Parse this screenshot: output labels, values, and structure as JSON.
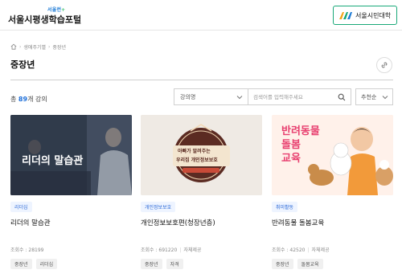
{
  "header": {
    "logo_small": "서울런",
    "logo_plus": "+",
    "logo_main": "서울시평생학습포털",
    "univ_button": "서울시민대학"
  },
  "breadcrumb": [
    "생애주기별",
    "중장년"
  ],
  "page": {
    "title": "중장년"
  },
  "filter": {
    "count_prefix": "총",
    "count": "89",
    "count_suffix": "개 강의",
    "select_value": "강의명",
    "search_placeholder": "검색어를 입력해주세요",
    "sort_value": "추천순"
  },
  "cards": [
    {
      "thumb_text": "리더의 말습관",
      "tag": "리더십",
      "title": "리더의 말습관",
      "views_label": "조회수 : 28199",
      "chips": [
        "중장년",
        "리더십"
      ]
    },
    {
      "thumb_text_1": "아빠가 알려주는",
      "thumb_text_2": "우리집 개인정보보호",
      "tag": "개인정보보호",
      "title": "개인정보보호편(청장년층)",
      "views_label": "조회수 : 691220",
      "source": "자체제공",
      "chips": [
        "중장년",
        "자격"
      ]
    },
    {
      "thumb_text_1": "반려동물",
      "thumb_text_2": "돌봄",
      "thumb_text_3": "교육",
      "tag": "취미활동",
      "title": "반려동물 돌봄교육",
      "views_label": "조회수 : 42520",
      "source": "자체제공",
      "chips": [
        "중장년",
        "돌봄교육"
      ]
    }
  ],
  "colors": {
    "accent_blue": "#1e6fd9",
    "brand_green": "#18a878",
    "pink": "#e83f6f"
  }
}
